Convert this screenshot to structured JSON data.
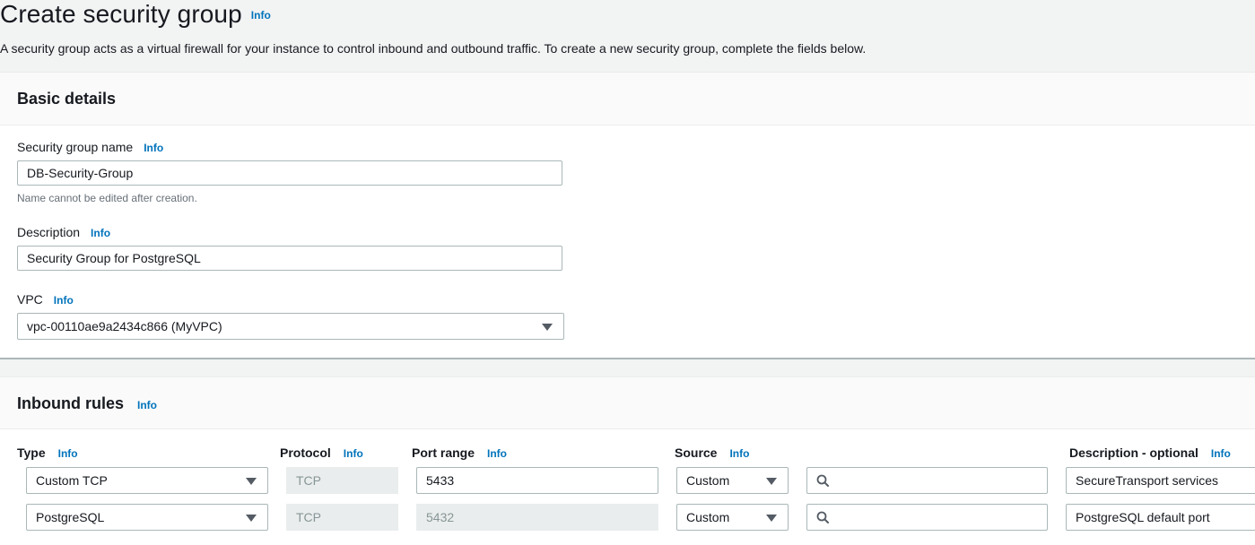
{
  "header": {
    "title": "Create security group",
    "info": "Info",
    "description": "A security group acts as a virtual firewall for your instance to control inbound and outbound traffic. To create a new security group, complete the fields below."
  },
  "basic_details": {
    "heading": "Basic details",
    "name": {
      "label": "Security group name",
      "info": "Info",
      "value": "DB-Security-Group",
      "hint": "Name cannot be edited after creation."
    },
    "description": {
      "label": "Description",
      "info": "Info",
      "value": "Security Group for PostgreSQL"
    },
    "vpc": {
      "label": "VPC",
      "info": "Info",
      "selected": "vpc-00110ae9a2434c866 (MyVPC)"
    }
  },
  "inbound_rules": {
    "heading": "Inbound rules",
    "info": "Info",
    "columns": {
      "type": "Type",
      "protocol": "Protocol",
      "port_range": "Port range",
      "source": "Source",
      "description": "Description - optional",
      "info": "Info"
    },
    "rows": [
      {
        "type": "Custom TCP",
        "protocol": "TCP",
        "port_range": "5433",
        "port_editable": true,
        "source": "Custom",
        "source_search": "",
        "description": "SecureTransport services"
      },
      {
        "type": "PostgreSQL",
        "protocol": "TCP",
        "port_range": "5432",
        "port_editable": false,
        "source": "Custom",
        "source_search": "",
        "description": "PostgreSQL default port"
      }
    ]
  },
  "colors": {
    "info_link": "#0073bb",
    "page_bg": "#f2f3f3",
    "border": "#aab7b8",
    "disabled_bg": "#eaeded"
  }
}
